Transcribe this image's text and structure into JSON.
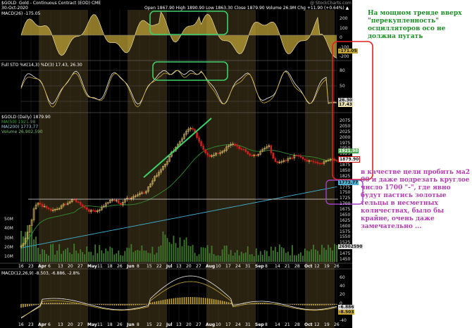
{
  "header": {
    "symbol": "$GOLD",
    "name": "Gold - Continuous Contract (EOD) CME",
    "date": "30-Oct-2020",
    "ohlc": "Open 1867.90  High 1890.90  Low 1863.30  Close 1879.90  Volume 26.9M  Chg +11.90 (+0.64%) ▲",
    "watermark": "@ StockCharts.com"
  },
  "panels": {
    "cci_label": "MACD(26) -175.05",
    "sto_label": "Full STO %K(14,3) %D(3) 17.43, 26.30",
    "price_label": "$GOLD (Daily) 1879.90",
    "ma50_label": "MA(50) 1921.98",
    "ma200_label": "MA(200) 1773.77",
    "volume_label": "Volume 26,902,590",
    "macd_label": "MACD(12,26,9) -8.503, -6.886, -2.8%"
  },
  "right_axis": {
    "cci": [
      "200",
      "100",
      "0",
      "-100",
      "-200"
    ],
    "sto": [
      "80",
      "50",
      "20"
    ],
    "price": [
      "2075",
      "2050",
      "2025",
      "2000",
      "1975",
      "1950",
      "1925",
      "1900",
      "1875",
      "1850",
      "1825",
      "1800",
      "1775",
      "1750",
      "1725",
      "1700",
      "1675",
      "1650",
      "1625",
      "1600",
      "1575",
      "1550",
      "1525",
      "1500",
      "1475",
      "1450"
    ],
    "macd": [
      "60",
      "40",
      "20",
      "0",
      "-20",
      "-40"
    ]
  },
  "left_axis": {
    "volume": [
      "50M",
      "40M",
      "30M",
      "20M",
      "10M"
    ]
  },
  "tags": {
    "cci": "-171.05",
    "sto_a": "26.30",
    "sto_b": "17.43",
    "ma50": "1921.98",
    "price": "1879.90",
    "ma200": "1773.77",
    "volume": "26902590",
    "macd_a": "-6.886",
    "macd_b": "-8.503"
  },
  "x_ticks": [
    "16",
    "23",
    "Apr",
    "6",
    "13",
    "20",
    "27",
    "May",
    "11",
    "18",
    "26",
    "Jun",
    "8",
    "15",
    "22",
    "Jul",
    "13",
    "20",
    "27",
    "Aug",
    "10",
    "17",
    "24",
    "31",
    "Sep",
    "8",
    "14",
    "21",
    "28",
    "Oct",
    "12",
    "19",
    "26"
  ],
  "annotations": {
    "top": "На мощном тренде вверх \"перекупленность\" осцилляторов осо не должна пугать",
    "bottom": "в качестве цели пробить ма2 00 и даже подрезать круглое число 1700 \"-\", где явно будут пастись золотые тельцы в несметных количествах, было бы крайне, очень даже замечательно ..."
  },
  "colors": {
    "background": "#000000",
    "band": "#2a2210",
    "gold": "#c8a93a",
    "line": "#e8d9a0",
    "up_candle": "#e0c060",
    "down_candle": "#d0201e",
    "ma50": "#2f8f2f",
    "ma200": "#3fb0d0",
    "volume": "#3f7a2f",
    "note_green": "#1f8f2a",
    "note_purple": "#b13fb0",
    "box_red": "#e02020",
    "box_purple": "#a040c0",
    "box_green": "#3ccf6a"
  }
}
